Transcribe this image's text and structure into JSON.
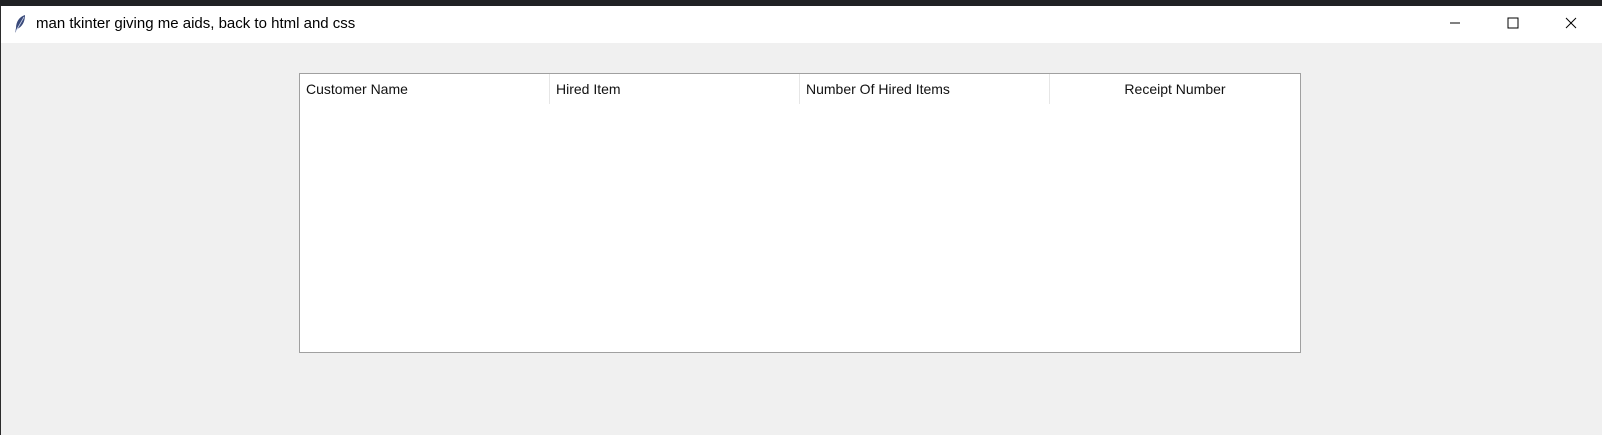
{
  "window": {
    "title": "man tkinter giving me aids, back to html and css",
    "icon": "feather-icon",
    "controls": {
      "minimize": "minimize-icon",
      "maximize": "maximize-icon",
      "close": "close-icon"
    }
  },
  "table": {
    "columns": [
      {
        "label": "Customer Name"
      },
      {
        "label": "Hired Item"
      },
      {
        "label": "Number Of Hired Items"
      },
      {
        "label": "Receipt Number"
      }
    ],
    "rows": []
  }
}
